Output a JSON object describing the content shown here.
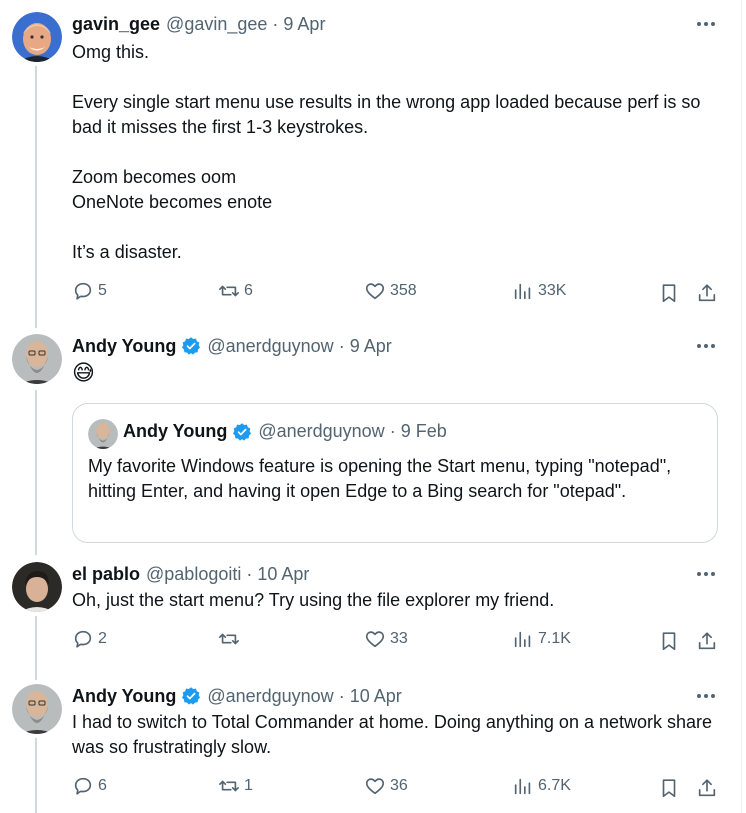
{
  "tweets": [
    {
      "name": "gavin_gee",
      "handle": "@gavin_gee",
      "date": "9 Apr",
      "text": "Omg this.\n\nEvery single start menu use results in the wrong app loaded because perf is so bad it misses the first 1-3 keystrokes.\n\nZoom becomes oom\nOneNote becomes enote\n\nIt’s a disaster.",
      "replies": "5",
      "reposts": "6",
      "likes": "358",
      "views": "33K"
    },
    {
      "name": "Andy Young",
      "handle": "@anerdguynow",
      "date": "9 Apr",
      "text": "😅",
      "quote": {
        "name": "Andy Young",
        "handle": "@anerdguynow",
        "date": "9 Feb",
        "text": "My favorite Windows feature is opening the Start menu, typing \"notepad\", hitting Enter, and having it open Edge to a Bing search for \"otepad\"."
      }
    },
    {
      "name": "el pablo",
      "handle": "@pablogoiti",
      "date": "10 Apr",
      "text": "Oh, just the start menu? Try using the file explorer my friend.",
      "replies": "2",
      "reposts": "",
      "likes": "33",
      "views": "7.1K"
    },
    {
      "name": "Andy Young",
      "handle": "@anerdguynow",
      "date": "10 Apr",
      "text": "I had to switch to Total Commander at home. Doing anything on a network share was so frustratingly slow.",
      "replies": "6",
      "reposts": "1",
      "likes": "36",
      "views": "6.7K"
    }
  ],
  "separator": "·",
  "colors": {
    "text": "#0f1419",
    "muted": "#536471",
    "verified": "#1d9bf0",
    "thread_line": "#cfd9de"
  }
}
